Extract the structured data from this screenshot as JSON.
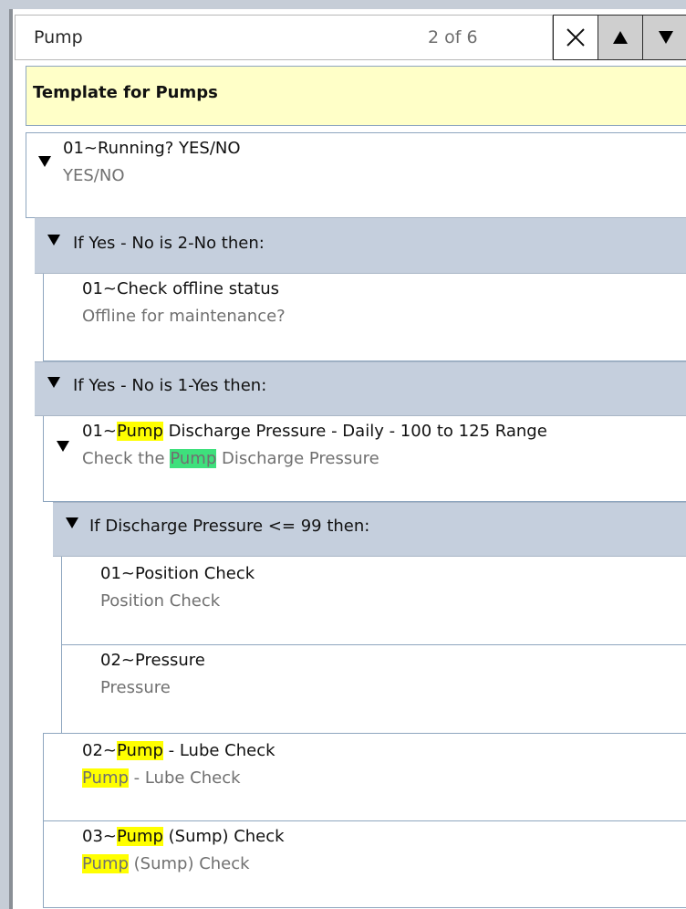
{
  "search": {
    "value": "Pump",
    "count": "2 of 6"
  },
  "template": {
    "title": "Template for Pumps"
  },
  "steps": {
    "running": {
      "title": "01~Running? YES/NO",
      "subtitle": "YES/NO"
    },
    "cond_no": {
      "label": "If Yes - No is 2-No then:"
    },
    "offline": {
      "title": "01~Check offline status",
      "subtitle": "Offline for maintenance?"
    },
    "cond_yes": {
      "label": "If Yes - No is 1-Yes then:"
    },
    "discharge": {
      "title_prefix": "01~",
      "title_match": "Pump",
      "title_suffix": " Discharge Pressure - Daily - 100 to 125 Range",
      "sub_prefix": "Check the ",
      "sub_match": "Pump",
      "sub_suffix": " Discharge Pressure"
    },
    "cond_pressure": {
      "label": "If Discharge Pressure <= 99 then:"
    },
    "position": {
      "title": "01~Position Check",
      "subtitle": "Position Check"
    },
    "pressure": {
      "title": "02~Pressure",
      "subtitle": "Pressure"
    },
    "lube": {
      "title_prefix": "02~",
      "title_match": "Pump",
      "title_suffix": " - Lube Check",
      "sub_match": "Pump",
      "sub_suffix": " - Lube Check"
    },
    "sump": {
      "title_prefix": "03~",
      "title_match": "Pump",
      "title_suffix": " (Sump) Check",
      "sub_match": "Pump",
      "sub_suffix": " (Sump) Check"
    }
  },
  "colors": {
    "highlight": "#ffff00",
    "current_match": "#3ee07c",
    "condition_band": "#c5cfdd",
    "template_header": "#ffffc8"
  }
}
